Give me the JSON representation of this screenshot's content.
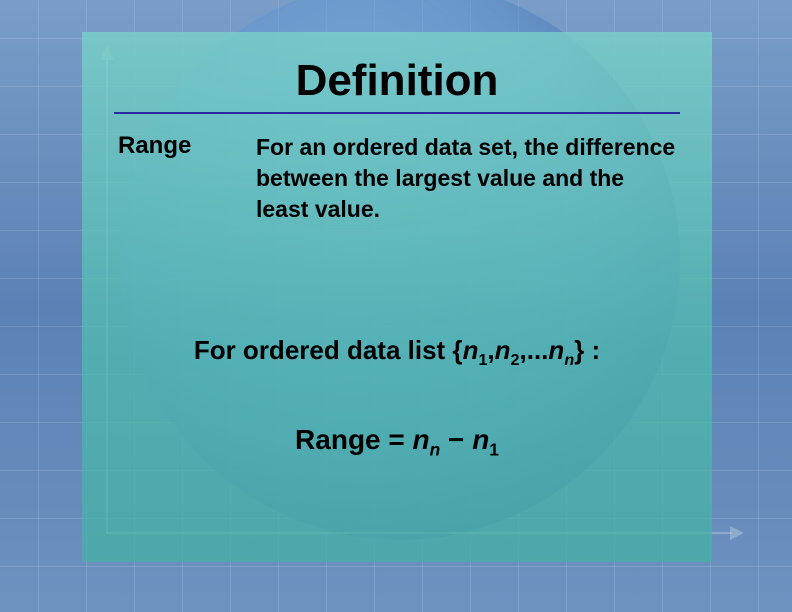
{
  "title": "Definition",
  "term": "Range",
  "description": "For an ordered data set, the difference between the largest value and the least value.",
  "formula_intro_prefix": "For ordered data list {",
  "formula_intro_suffix": "} :",
  "n1": "n",
  "sub1": "1",
  "n2": "n",
  "sub2": "2",
  "ellipsis": ",...",
  "nn": "n",
  "subn": "n",
  "comma": ",",
  "range_label": "Range",
  "eq": " = ",
  "minus": " − ",
  "res_nn": "n",
  "res_subn": "n",
  "res_n1": "n",
  "res_sub1": "1"
}
